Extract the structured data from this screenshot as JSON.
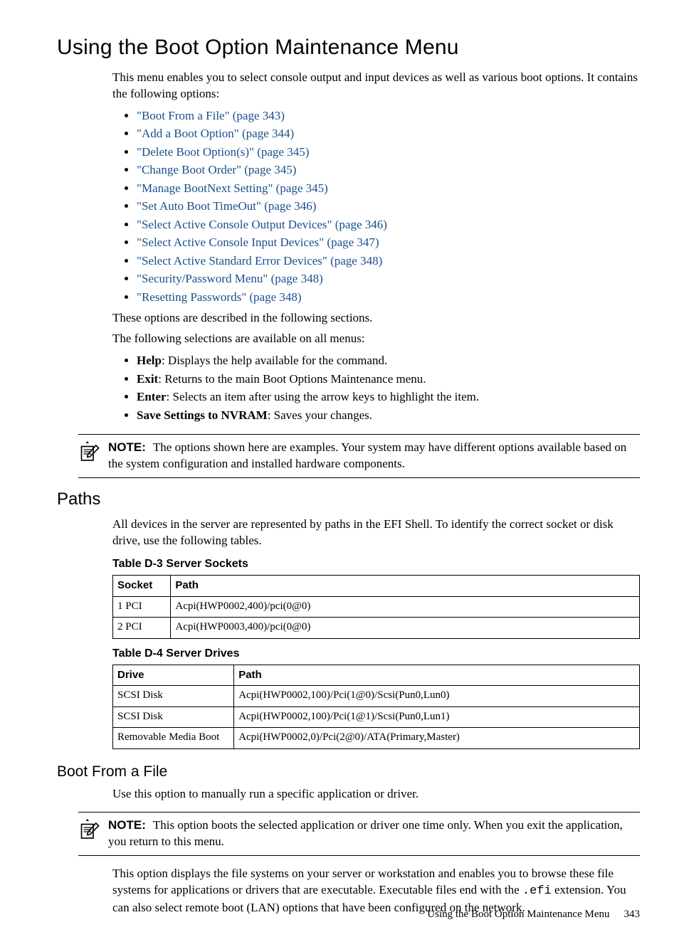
{
  "heading": "Using the Boot Option Maintenance Menu",
  "intro": "This menu enables you to select console output and input devices as well as various boot options. It contains the following options:",
  "links": [
    "\"Boot From a File\" (page 343)",
    "\"Add a Boot Option\" (page 344)",
    "\"Delete Boot Option(s)\" (page 345)",
    "\"Change Boot Order\" (page 345)",
    "\"Manage BootNext Setting\" (page 345)",
    "\"Set Auto Boot TimeOut\" (page 346)",
    "\"Select Active Console Output Devices\" (page 346)",
    "\"Select Active Console Input Devices\" (page 347)",
    "\"Select Active Standard Error Devices\" (page 348)",
    "\"Security/Password Menu\" (page 348)",
    "\"Resetting Passwords\" (page 348)"
  ],
  "para_described": "These options are described in the following sections.",
  "para_selections": "The following selections are available on all menus:",
  "selections": [
    {
      "term": "Help",
      "rest": ": Displays the help available for the command."
    },
    {
      "term": "Exit",
      "rest": ": Returns to the main Boot Options Maintenance menu."
    },
    {
      "term": "Enter",
      "rest": ": Selects an item after using the arrow keys to highlight the item."
    },
    {
      "term": "Save Settings to NVRAM",
      "rest": ": Saves your changes."
    }
  ],
  "note1": {
    "label": "NOTE:",
    "text": "The options shown here are examples. Your system may have different options available based on the system configuration and installed hardware components."
  },
  "paths": {
    "heading": "Paths",
    "intro": "All devices in the server are represented by paths in the EFI Shell. To identify the correct socket or disk drive, use the following tables.",
    "table1": {
      "caption": "Table  D-3  Server Sockets",
      "headers": [
        "Socket",
        "Path"
      ],
      "rows": [
        [
          "1 PCI",
          "Acpi(HWP0002,400)/pci(0@0)"
        ],
        [
          "2 PCI",
          "Acpi(HWP0003,400)/pci(0@0)"
        ]
      ]
    },
    "table2": {
      "caption": "Table  D-4  Server Drives",
      "headers": [
        "Drive",
        "Path"
      ],
      "rows": [
        [
          "SCSI Disk",
          "Acpi(HWP0002,100)/Pci(1@0)/Scsi(Pun0,Lun0)"
        ],
        [
          "SCSI Disk",
          "Acpi(HWP0002,100)/Pci(1@1)/Scsi(Pun0,Lun1)"
        ],
        [
          "Removable Media Boot",
          "Acpi(HWP0002,0)/Pci(2@0)/ATA(Primary,Master)"
        ]
      ]
    }
  },
  "boot_from_file": {
    "heading": "Boot From a File",
    "intro": "Use this option to manually run a specific application or driver.",
    "note_label": "NOTE:",
    "note_text": "This option boots the selected application or driver one time only. When you exit the application, you return to this menu.",
    "para_pre": "This option displays the file systems on your server or workstation and enables you to browse these file systems for applications or drivers that are executable. Executable files end with the ",
    "efi": ".efi",
    "para_post": " extension. You can also select remote boot (LAN) options that have been configured on the network."
  },
  "footer": {
    "title": "Using the Boot Option Maintenance Menu",
    "page": "343"
  }
}
